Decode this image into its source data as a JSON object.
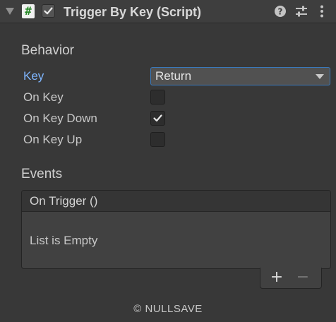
{
  "header": {
    "title": "Trigger By Key (Script)",
    "script_icon_glyph": "#",
    "enabled": true,
    "icons": [
      "foldout-arrow-icon",
      "script-icon",
      "help-icon",
      "preset-icon",
      "more-icon"
    ]
  },
  "behavior": {
    "title": "Behavior",
    "key_label": "Key",
    "key_value": "Return",
    "on_key_label": "On Key",
    "on_key_checked": false,
    "on_key_down_label": "On Key Down",
    "on_key_down_checked": true,
    "on_key_up_label": "On Key Up",
    "on_key_up_checked": false
  },
  "events": {
    "title": "Events",
    "event_name": "On Trigger ()",
    "empty_text": "List is Empty",
    "add_label": "+",
    "remove_label": "−"
  },
  "footer": {
    "copyright": "© NULLSAVE"
  },
  "colors": {
    "background": "#383838",
    "accent_label": "#7fb6ff",
    "dropdown_focus": "#3a79bb",
    "script_icon_hash": "#2a8a2a"
  }
}
